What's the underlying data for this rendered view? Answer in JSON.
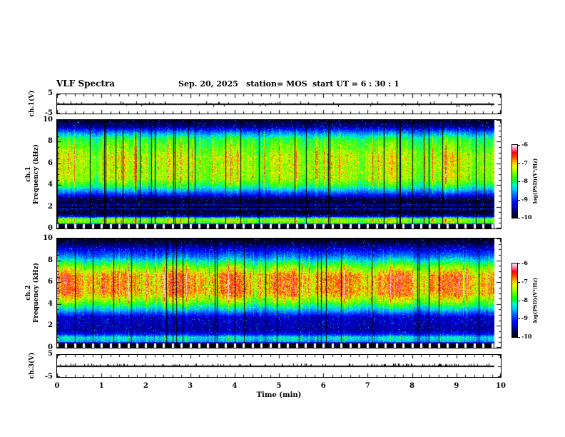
{
  "header": {
    "title": "VLF Spectra",
    "date": "Sep. 20, 2025",
    "station": "station= MOS",
    "start_ut": "start UT =  6 : 30 : 1"
  },
  "chart_data": {
    "type": "heatmap",
    "title": "VLF Spectra",
    "xlabel": "Time (min)",
    "xlim": [
      0,
      10
    ],
    "xticks": [
      0,
      1,
      2,
      3,
      4,
      5,
      6,
      7,
      8,
      9,
      10
    ],
    "x_minor_step": 0.2,
    "value_label": "log(PSD)(V²/Hz)",
    "value_range": [
      -10,
      -6
    ],
    "colormap": {
      "stops": [
        {
          "t": 0.0,
          "color": "#000000"
        },
        {
          "t": 0.1,
          "color": "#000080"
        },
        {
          "t": 0.2,
          "color": "#0000ff"
        },
        {
          "t": 0.3,
          "color": "#0060ff"
        },
        {
          "t": 0.38,
          "color": "#00c0ff"
        },
        {
          "t": 0.45,
          "color": "#00ffd0"
        },
        {
          "t": 0.5,
          "color": "#00ff40"
        },
        {
          "t": 0.56,
          "color": "#30ff00"
        },
        {
          "t": 0.63,
          "color": "#90ff00"
        },
        {
          "t": 0.7,
          "color": "#e8ff00"
        },
        {
          "t": 0.75,
          "color": "#ffd000"
        },
        {
          "t": 0.8,
          "color": "#ff8000"
        },
        {
          "t": 0.85,
          "color": "#ff3000"
        },
        {
          "t": 0.9,
          "color": "#ff0020"
        },
        {
          "t": 0.95,
          "color": "#ff80b0"
        },
        {
          "t": 1.0,
          "color": "#ffeaea"
        }
      ]
    },
    "panels": [
      {
        "id": "ch1-waveform",
        "kind": "waveform",
        "ylabel": "ch.1(V)",
        "ylim": [
          -5,
          5
        ],
        "ytick_labels": [
          "5",
          "-5"
        ],
        "baseline_volts": 0,
        "texture": {
          "seed": 3,
          "spike_prob": 0.1,
          "spike_dir": "both"
        }
      },
      {
        "id": "ch1-spectrogram",
        "kind": "spectrogram",
        "ylabel_line1": "ch.1",
        "ylabel_line2": "Frequency (kHz)",
        "ylim": [
          0,
          10
        ],
        "yticks": [
          0,
          2,
          4,
          6,
          8,
          10
        ],
        "y_minor_step": 0.5,
        "profile": [
          [
            0,
            -10
          ],
          [
            0.35,
            -10
          ],
          [
            0.5,
            -7.8
          ],
          [
            0.85,
            -7.3
          ],
          [
            1.1,
            -9.3
          ],
          [
            1.35,
            -9.85
          ],
          [
            1.72,
            -9.85
          ],
          [
            1.8,
            -9.1
          ],
          [
            1.88,
            -9.85
          ],
          [
            2.08,
            -9.85
          ],
          [
            2.16,
            -9.15
          ],
          [
            2.24,
            -9.85
          ],
          [
            2.7,
            -9.8
          ],
          [
            3.2,
            -9.0
          ],
          [
            4.0,
            -7.9
          ],
          [
            4.6,
            -7.45
          ],
          [
            6.6,
            -7.35
          ],
          [
            8.2,
            -7.9
          ],
          [
            8.9,
            -8.8
          ],
          [
            9.4,
            -9.6
          ],
          [
            10,
            -9.9
          ]
        ],
        "texture": {
          "seed": 7,
          "noise": 0.55,
          "dropout_prob": 0.055,
          "hot_prob": 0.06
        }
      },
      {
        "id": "ch2-spectrogram",
        "kind": "spectrogram",
        "ylabel_line1": "ch.2",
        "ylabel_line2": "Frequency (kHz)",
        "ylim": [
          0,
          10
        ],
        "yticks": [
          0,
          2,
          4,
          6,
          8,
          10
        ],
        "y_minor_step": 0.5,
        "profile": [
          [
            0,
            -10
          ],
          [
            0.4,
            -10
          ],
          [
            0.55,
            -8.6
          ],
          [
            0.95,
            -8.3
          ],
          [
            1.25,
            -9.2
          ],
          [
            1.6,
            -9.5
          ],
          [
            2.8,
            -9.4
          ],
          [
            3.4,
            -8.6
          ],
          [
            4.2,
            -7.6
          ],
          [
            5.0,
            -6.9
          ],
          [
            6.6,
            -6.9
          ],
          [
            7.4,
            -7.6
          ],
          [
            8.3,
            -8.7
          ],
          [
            9.1,
            -9.4
          ],
          [
            9.6,
            -9.8
          ],
          [
            10,
            -9.95
          ]
        ],
        "texture": {
          "seed": 13,
          "noise": 0.55,
          "dropout_prob": 0.055,
          "hot_prob": 0.05
        }
      },
      {
        "id": "ch3-waveform",
        "kind": "waveform",
        "ylabel": "ch.3(V)",
        "ylim": [
          -5,
          5
        ],
        "ytick_labels": [
          "5",
          "-5"
        ],
        "baseline_volts": 0,
        "texture": {
          "seed": 5,
          "spike_prob": 0.18,
          "spike_dir": "up"
        }
      }
    ],
    "colorbars": [
      {
        "label": "log(PSD)(V²/Hz)",
        "ticks": [
          -6,
          -7,
          -8,
          -9,
          -10
        ],
        "range": [
          -6,
          -10
        ]
      },
      {
        "label": "log(PSD)(V²/Hz)",
        "ticks": [
          -6,
          -7,
          -8,
          -9,
          -10
        ],
        "range": [
          -6,
          -10
        ]
      }
    ]
  }
}
